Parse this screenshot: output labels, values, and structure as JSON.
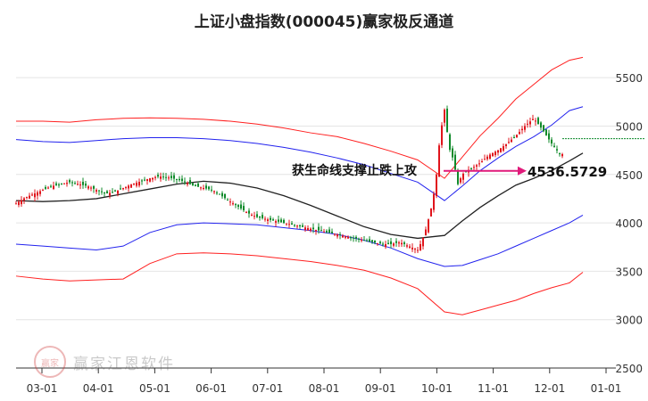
{
  "chart_data": {
    "type": "line",
    "title": "上证小盘指数(000045)赢家极反通道",
    "y_ticks": [
      5500,
      5000,
      4500,
      4000,
      3500,
      3000,
      2500
    ],
    "x_ticks": [
      "03-01",
      "04-01",
      "05-01",
      "06-01",
      "07-01",
      "08-01",
      "09-01",
      "10-01",
      "11-01",
      "12-01",
      "01-01"
    ],
    "ylim": [
      2500,
      5750
    ],
    "annotation_text": "获生命线支撑止跌上攻",
    "annotation_value": "4536.5729",
    "last_close": 4870,
    "colors": {
      "up": "#e0141c",
      "down": "#0f8a2a",
      "outer_band": "#ff2020",
      "inner_band": "#2222ee",
      "center_line": "#222222",
      "arrow": "#e01a7a",
      "grid": "#e4e4e4",
      "last_price_line": "#0b8a2a"
    },
    "series": [
      {
        "name": "",
        "x": [
          0,
          30,
          60,
          90,
          120,
          150,
          180,
          210,
          240,
          270,
          300,
          330,
          360,
          390,
          420,
          450,
          480,
          500,
          520,
          540,
          560,
          580,
          600,
          620,
          635
        ],
        "values": [
          5050,
          5050,
          5040,
          5065,
          5080,
          5085,
          5080,
          5070,
          5050,
          5020,
          4980,
          4930,
          4890,
          4820,
          4740,
          4650,
          4460,
          4680,
          4900,
          5080,
          5280,
          5430,
          5580,
          5680,
          5710
        ]
      },
      {
        "name": "",
        "x": [
          0,
          30,
          60,
          90,
          120,
          150,
          180,
          210,
          240,
          270,
          300,
          330,
          360,
          390,
          420,
          450,
          480,
          500,
          520,
          540,
          560,
          580,
          600,
          620,
          635
        ],
        "values": [
          4860,
          4840,
          4830,
          4850,
          4870,
          4880,
          4880,
          4870,
          4850,
          4820,
          4780,
          4730,
          4670,
          4600,
          4510,
          4420,
          4230,
          4380,
          4540,
          4670,
          4790,
          4890,
          5010,
          5160,
          5200
        ]
      },
      {
        "name": "",
        "x": [
          0,
          30,
          60,
          90,
          120,
          150,
          180,
          210,
          240,
          270,
          300,
          330,
          360,
          390,
          420,
          450,
          480,
          500,
          520,
          540,
          560,
          580,
          600,
          620,
          635
        ],
        "values": [
          4230,
          4220,
          4230,
          4250,
          4300,
          4350,
          4400,
          4430,
          4410,
          4360,
          4280,
          4180,
          4070,
          3960,
          3880,
          3840,
          3870,
          4020,
          4160,
          4280,
          4390,
          4460,
          4540,
          4640,
          4720
        ]
      },
      {
        "name": "",
        "x": [
          0,
          30,
          60,
          90,
          120,
          150,
          180,
          210,
          240,
          270,
          300,
          330,
          360,
          390,
          420,
          450,
          480,
          500,
          520,
          540,
          560,
          580,
          600,
          620,
          635
        ],
        "values": [
          3780,
          3760,
          3740,
          3720,
          3760,
          3900,
          3980,
          4000,
          3990,
          3980,
          3950,
          3920,
          3880,
          3820,
          3740,
          3630,
          3550,
          3560,
          3620,
          3680,
          3760,
          3840,
          3920,
          4000,
          4080
        ]
      },
      {
        "name": "",
        "x": [
          0,
          30,
          60,
          90,
          120,
          150,
          180,
          210,
          240,
          270,
          300,
          330,
          360,
          390,
          420,
          450,
          480,
          500,
          520,
          540,
          560,
          580,
          600,
          620,
          635
        ],
        "values": [
          3450,
          3420,
          3400,
          3410,
          3420,
          3580,
          3680,
          3690,
          3680,
          3660,
          3630,
          3600,
          3560,
          3510,
          3430,
          3320,
          3080,
          3050,
          3100,
          3150,
          3200,
          3270,
          3330,
          3380,
          3490
        ]
      },
      {
        "name": "",
        "x": [
          0,
          10,
          20,
          30,
          40,
          50,
          60,
          70,
          80,
          90,
          100,
          110,
          120,
          130,
          140,
          150,
          160,
          170,
          180,
          190,
          200,
          210,
          220,
          230,
          240,
          250,
          260,
          270,
          280,
          290,
          300,
          310,
          320,
          330,
          340,
          350,
          360,
          370,
          380,
          390,
          400,
          410,
          420,
          430,
          440,
          450,
          455,
          460,
          465,
          470,
          475,
          480,
          485,
          490,
          495,
          500,
          505,
          510,
          520,
          530,
          540,
          550,
          560,
          570,
          580,
          590,
          600,
          610,
          620,
          630,
          635
        ],
        "values": [
          4200,
          4260,
          4300,
          4340,
          4380,
          4400,
          4420,
          4400,
          4380,
          4340,
          4300,
          4320,
          4360,
          4400,
          4430,
          4460,
          4480,
          4470,
          4450,
          4420,
          4380,
          4360,
          4340,
          4280,
          4220,
          4160,
          4100,
          4060,
          4040,
          4020,
          4000,
          3980,
          3960,
          3940,
          3920,
          3900,
          3880,
          3860,
          3840,
          3820,
          3800,
          3780,
          3780,
          3800,
          3760,
          3720,
          3820,
          3960,
          4150,
          4400,
          4900,
          5170,
          4780,
          4650,
          4400,
          4500,
          4540,
          4560,
          4620,
          4700,
          4750,
          4820,
          4900,
          5000,
          5080,
          4960,
          4820,
          4700,
          4750,
          4820,
          4870
        ]
      }
    ]
  }
}
